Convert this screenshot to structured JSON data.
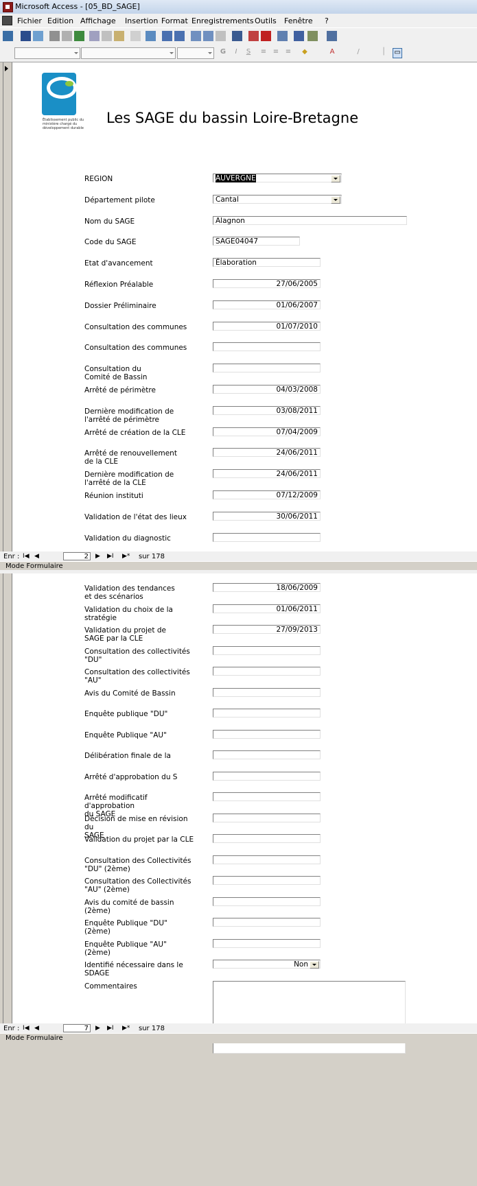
{
  "window": {
    "title": "Microsoft Access - [05_BD_SAGE]"
  },
  "menu": [
    "Fichier",
    "Edition",
    "Affichage",
    "Insertion",
    "Format",
    "Enregistrements",
    "Outils",
    "Fenêtre",
    "?"
  ],
  "header": {
    "title": "Les SAGE du bassin Loire-Bretagne",
    "logo_caption": "Établissement public du ministère chargé du développement durable"
  },
  "form1": [
    {
      "label": "REGION",
      "value": "AUVERGNE",
      "dropdown": true,
      "selected": true,
      "w": 188
    },
    {
      "label": "Département pilote",
      "value": "Cantal",
      "dropdown": true,
      "w": 188
    },
    {
      "label": "Nom du SAGE",
      "value": "Alagnon",
      "w": 283
    },
    {
      "label": "Code du SAGE",
      "value": "SAGE04047",
      "w": 127
    },
    {
      "label": "Etat d'avancement",
      "value": "Élaboration",
      "w": 157
    },
    {
      "label": "Réflexion Préalable",
      "value": "27/06/2005",
      "align": "r",
      "w": 157
    },
    {
      "label": "Dossier Préliminaire",
      "value": "01/06/2007",
      "align": "r",
      "w": 157
    },
    {
      "label": "Consultation des communes",
      "value": "01/07/2010",
      "align": "r",
      "w": 157
    },
    {
      "label": "Consultation des communes",
      "value": "",
      "w": 157
    },
    {
      "label": "Consultation du\nComité de Bassin",
      "value": "",
      "w": 157
    },
    {
      "label": "Arrêté de périmètre",
      "value": "04/03/2008",
      "align": "r",
      "w": 157
    },
    {
      "label": "Dernière modification de\nl'arrêté de périmètre",
      "value": "03/08/2011",
      "align": "r",
      "w": 157
    },
    {
      "label": "Arrêté de création de la CLE",
      "value": "07/04/2009",
      "align": "r",
      "w": 157
    },
    {
      "label": "Arrêté de renouvellement\nde la CLE",
      "value": "24/06/2011",
      "align": "r",
      "w": 157
    },
    {
      "label": "Dernière modification de\nl'arrêté de la CLE",
      "value": "24/06/2011",
      "align": "r",
      "w": 157
    },
    {
      "label": "Réunion instituti",
      "value": "07/12/2009",
      "align": "r",
      "w": 157
    },
    {
      "label": "Validation de l'état des lieux",
      "value": "30/06/2011",
      "align": "r",
      "w": 157
    },
    {
      "label": "Validation du diagnostic",
      "value": "",
      "w": 157
    }
  ],
  "form2": [
    {
      "label": "Validation des tendances\net des scénarios",
      "value": "18/06/2009",
      "align": "r",
      "w": 157
    },
    {
      "label": "Validation du choix de la\nstratégie",
      "value": "01/06/2011",
      "align": "r",
      "w": 157
    },
    {
      "label": "Validation du projet de\nSAGE par la CLE",
      "value": "27/09/2013",
      "align": "r",
      "w": 157
    },
    {
      "label": "Consultation des collectivités \"DU\"",
      "value": "",
      "w": 157
    },
    {
      "label": "Consultation des collectivités \"AU\"",
      "value": "",
      "w": 157
    },
    {
      "label": "Avis du Comité de Bassin",
      "value": "",
      "w": 157
    },
    {
      "label": "Enquête publique \"DU\"",
      "value": "",
      "w": 157
    },
    {
      "label": "Enquête Publique \"AU\"",
      "value": "",
      "w": 157
    },
    {
      "label": "Délibération finale de la",
      "value": "",
      "w": 157
    },
    {
      "label": "Arrêté d'approbation du S",
      "value": "",
      "w": 157
    },
    {
      "label": "Arrêté modificatif d'approbation\ndu SAGE",
      "value": "",
      "w": 157
    },
    {
      "label": "Décision de mise en révision du\nSAGE",
      "value": "",
      "w": 157
    },
    {
      "label": "Validation du projet par la CLE",
      "value": "",
      "w": 157
    },
    {
      "label": "Consultation des Collectivités\n\"DU\" (2ème)",
      "value": "",
      "w": 157
    },
    {
      "label": "Consultation des Collectivités\n\"AU\" (2ème)",
      "value": "",
      "w": 157
    },
    {
      "label": "Avis du comité de bassin (2ème)",
      "value": "",
      "w": 157
    },
    {
      "label": "Enquête Publique \"DU\" (2ème)",
      "value": "",
      "w": 157
    },
    {
      "label": "Enquête Publique \"AU\" (2ème)",
      "value": "",
      "w": 157
    },
    {
      "label": "Identifié nécessaire dans le\nSDAGE",
      "value": "Non",
      "dropdown": true,
      "align": "r",
      "w": 157
    },
    {
      "label": "Commentaires",
      "value": "",
      "w": 281,
      "h": 106
    }
  ],
  "nav1": {
    "label": "Enr :",
    "record": "2",
    "total": "sur  178"
  },
  "nav2": {
    "label": "Enr :",
    "record": "7",
    "total": "sur  178"
  },
  "status": {
    "mode": "Mode Formulaire"
  }
}
